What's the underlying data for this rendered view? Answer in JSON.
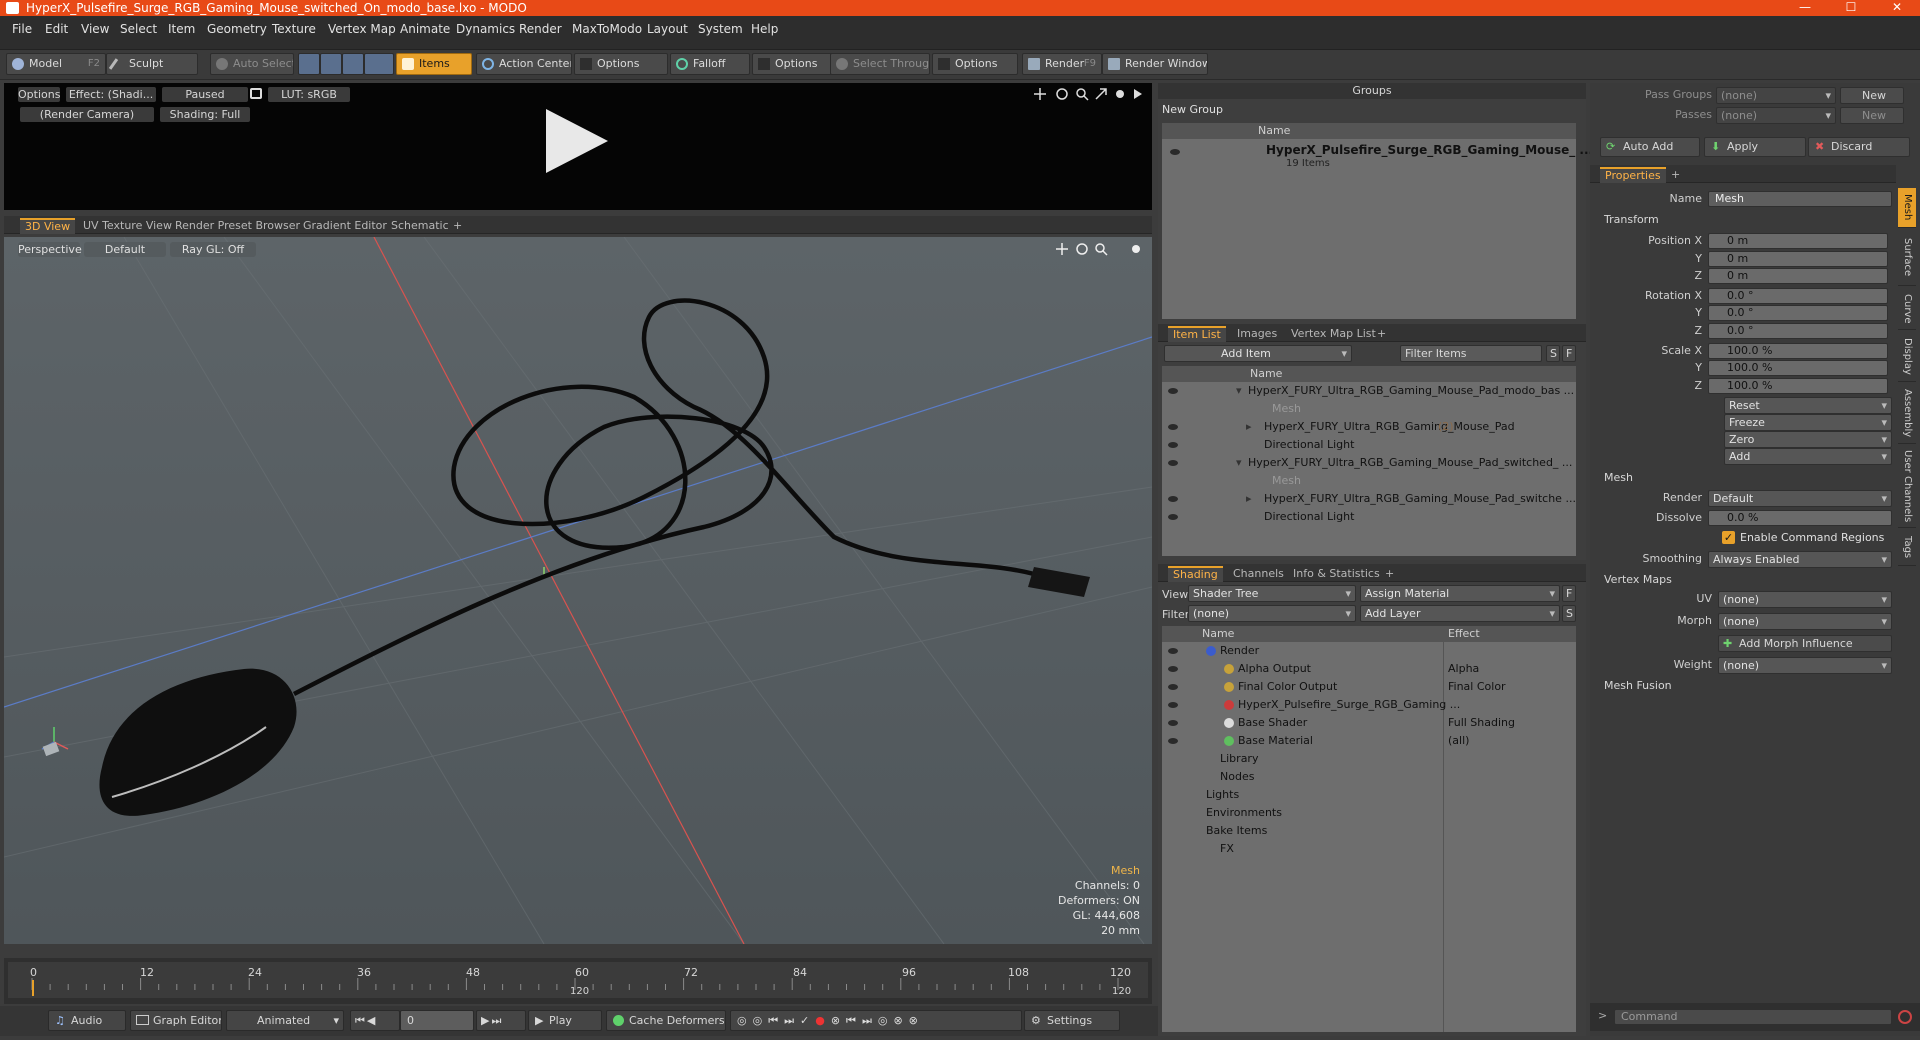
{
  "window": {
    "title": "HyperX_Pulsefire_Surge_RGB_Gaming_Mouse_switched_On_modo_base.lxo - MODO",
    "minimize": "—",
    "maximize": "☐",
    "close": "✕"
  },
  "menu": [
    "File",
    "Edit",
    "View",
    "Select",
    "Item",
    "Geometry",
    "Texture",
    "Vertex Map",
    "Animate",
    "Dynamics",
    "Render",
    "MaxToModo",
    "Layout",
    "System",
    "Help"
  ],
  "toolbar": {
    "model": "Model",
    "model_key": "F2",
    "sculpt": "Sculpt",
    "auto_select": "Auto Select",
    "items": "Items",
    "action_center": "Action Center",
    "options1": "Options",
    "falloff": "Falloff",
    "options2": "Options",
    "select_through": "Select Through",
    "options3": "Options",
    "render": "Render",
    "render_key": "F9",
    "render_window": "Render Window"
  },
  "preview": {
    "options": "Options",
    "effect": "Effect: (Shadi...",
    "paused": "Paused",
    "lut": "LUT: sRGB",
    "camera": "(Render Camera)",
    "shading": "Shading: Full"
  },
  "viewport_tabs": [
    "3D View",
    "UV Texture View",
    "Render Preset Browser",
    "Gradient Editor",
    "Schematic",
    "+"
  ],
  "viewport": {
    "perspective": "Perspective",
    "default": "Default",
    "raygl": "Ray GL: Off",
    "info": [
      "Mesh",
      "Channels: 0",
      "Deformers: ON",
      "GL: 444,608",
      "20 mm"
    ]
  },
  "timeline": {
    "ticks": [
      "0",
      "12",
      "24",
      "36",
      "48",
      "60",
      "72",
      "84",
      "96",
      "108",
      "120"
    ],
    "mid_label": "120",
    "end_label": "120"
  },
  "bottombar": {
    "audio": "Audio",
    "graph_editor": "Graph Editor",
    "animated": "Animated",
    "frame": "0",
    "play": "Play",
    "cache": "Cache Deformers",
    "settings": "Settings"
  },
  "groups": {
    "title": "Groups",
    "new_group": "New Group",
    "col_name": "Name",
    "item_name": "HyperX_Pulsefire_Surge_RGB_Gaming_Mouse_ ...",
    "item_count": "19 Items"
  },
  "itemlist": {
    "tabs": [
      "Item List",
      "Images",
      "Vertex Map List",
      "+"
    ],
    "add_item": "Add Item",
    "filter": "Filter Items",
    "s": "S",
    "f": "F",
    "col_name": "Name",
    "rows": [
      {
        "label": "HyperX_FURY_Ultra_RGB_Gaming_Mouse_Pad_modo_bas ...",
        "indent": 0,
        "dim": false
      },
      {
        "label": "Mesh",
        "indent": 2,
        "dim": true
      },
      {
        "label": "HyperX_FURY_Ultra_RGB_Gaming_Mouse_Pad",
        "suffix": "(2)",
        "indent": 1,
        "dim": false
      },
      {
        "label": "Directional Light",
        "indent": 1,
        "dim": false
      },
      {
        "label": "HyperX_FURY_Ultra_RGB_Gaming_Mouse_Pad_switched_ ...",
        "indent": 0,
        "dim": false
      },
      {
        "label": "Mesh",
        "indent": 2,
        "dim": true
      },
      {
        "label": "HyperX_FURY_Ultra_RGB_Gaming_Mouse_Pad_switche ...",
        "indent": 1,
        "dim": false
      },
      {
        "label": "Directional Light",
        "indent": 1,
        "dim": false
      }
    ]
  },
  "shading": {
    "tabs": [
      "Shading",
      "Channels",
      "Info & Statistics",
      "+"
    ],
    "view_label": "View",
    "view_value": "Shader Tree",
    "assign": "Assign Material",
    "filter_label": "Filter",
    "filter_value": "(none)",
    "add_layer": "Add Layer",
    "f": "F",
    "s": "S",
    "col_name": "Name",
    "col_effect": "Effect",
    "rows": [
      {
        "name": "Render",
        "effect": "",
        "indent": 0
      },
      {
        "name": "Alpha Output",
        "effect": "Alpha",
        "indent": 1
      },
      {
        "name": "Final Color Output",
        "effect": "Final Color",
        "indent": 1
      },
      {
        "name": "HyperX_Pulsefire_Surge_RGB_Gaming ...",
        "effect": "",
        "indent": 1
      },
      {
        "name": "Base Shader",
        "effect": "Full Shading",
        "indent": 1
      },
      {
        "name": "Base Material",
        "effect": "(all)",
        "indent": 1
      },
      {
        "name": "Library",
        "effect": "",
        "indent": 1
      },
      {
        "name": "Nodes",
        "effect": "",
        "indent": 1
      },
      {
        "name": "Lights",
        "effect": "",
        "indent": 0
      },
      {
        "name": "Environments",
        "effect": "",
        "indent": 0
      },
      {
        "name": "Bake Items",
        "effect": "",
        "indent": 0
      },
      {
        "name": "FX",
        "effect": "",
        "indent": 1
      }
    ]
  },
  "right": {
    "pass_groups": "Pass Groups",
    "passes": "Passes",
    "none": "(none)",
    "new": "New",
    "auto_add": "Auto Add",
    "apply": "Apply",
    "discard": "Discard",
    "properties_tab": "Properties",
    "plus": "+",
    "name_label": "Name",
    "name_value": "Mesh",
    "transform": "Transform",
    "position_label": "Position X",
    "rotation_label": "Rotation X",
    "scale_label": "Scale X",
    "y": "Y",
    "z": "Z",
    "pos": [
      "0 m",
      "0 m",
      "0 m"
    ],
    "rot": [
      "0.0 °",
      "0.0 °",
      "0.0 °"
    ],
    "scale": [
      "100.0 %",
      "100.0 %",
      "100.0 %"
    ],
    "reset": "Reset",
    "freeze": "Freeze",
    "zero": "Zero",
    "add": "Add",
    "mesh_section": "Mesh",
    "render_label": "Render",
    "render_value": "Default",
    "dissolve_label": "Dissolve",
    "dissolve_value": "0.0 %",
    "enable_cmd": "Enable Command Regions",
    "smoothing_label": "Smoothing",
    "smoothing_value": "Always Enabled",
    "vertex_maps": "Vertex Maps",
    "uv_label": "UV",
    "morph_label": "Morph",
    "add_morph": "Add Morph Influence",
    "weight_label": "Weight",
    "mesh_fusion": "Mesh Fusion",
    "command": "Command",
    "vtabs": [
      "Mesh",
      "Surface",
      "Curve",
      "Display",
      "Assembly",
      "User Channels",
      "Tags"
    ]
  }
}
